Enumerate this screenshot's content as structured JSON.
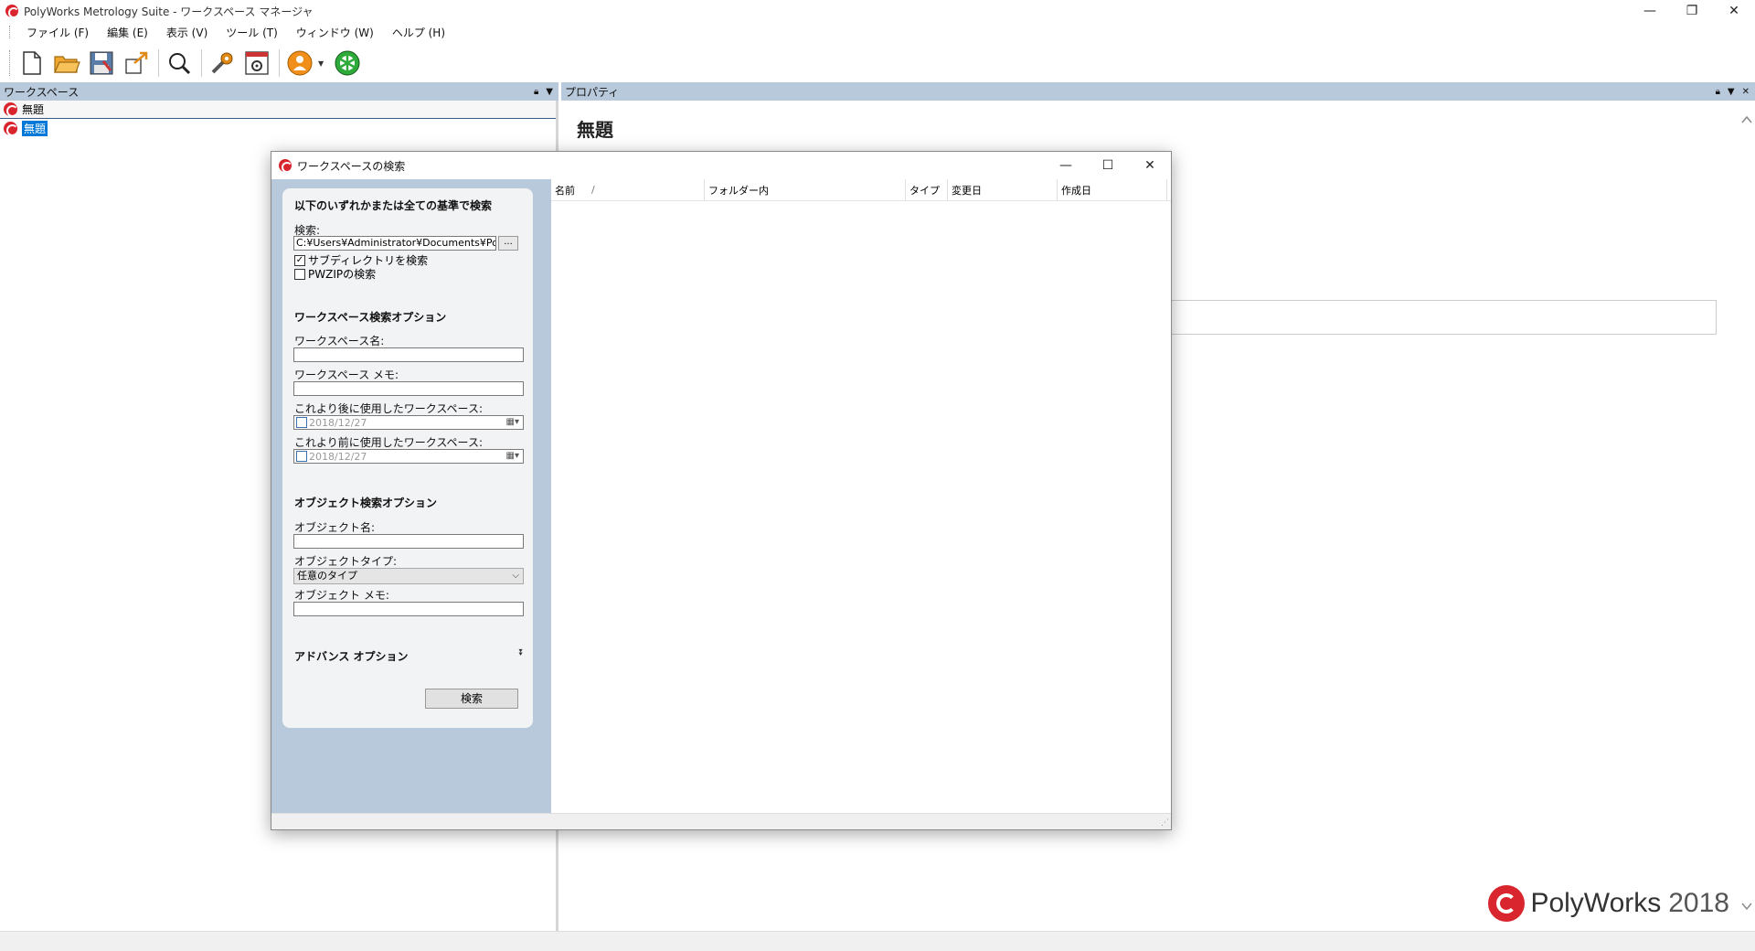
{
  "window": {
    "title": "PolyWorks Metrology Suite - ワークスペース マネージャ",
    "minimize": "—",
    "restore": "❐",
    "close": "✕"
  },
  "menu": [
    {
      "label": "ファイル (F)"
    },
    {
      "label": "編集 (E)"
    },
    {
      "label": "表示 (V)"
    },
    {
      "label": "ツール (T)"
    },
    {
      "label": "ウィンドウ (W)"
    },
    {
      "label": "ヘルプ (H)"
    }
  ],
  "toolbar": {
    "icons": [
      "new-file-icon",
      "open-folder-icon",
      "save-icon",
      "export-icon",
      "search-icon",
      "tools-icon",
      "settings-icon",
      "user-icon",
      "network-icon"
    ]
  },
  "workspace_panel": {
    "title": "ワークスペース",
    "items": [
      {
        "label": "無題"
      },
      {
        "label": "無題"
      }
    ]
  },
  "properties_panel": {
    "title": "プロパティ",
    "heading": "無題"
  },
  "brand": {
    "name": "PolyWorks",
    "year": "2018"
  },
  "dialog": {
    "title": "ワークスペースの検索",
    "criteria_heading": "以下のいずれかまたは全ての基準で検索",
    "search_label": "検索:",
    "search_path": "C:¥Users¥Administrator¥Documents¥PolyWorks",
    "browse": "...",
    "search_subdirs": "サブディレクトリを検索",
    "search_pwzip": "PWZIPの検索",
    "ws_options_heading": "ワークスペース検索オプション",
    "ws_name_label": "ワークスペース名:",
    "ws_memo_label": "ワークスペース メモ:",
    "used_after_label": "これより後に使用したワークスペース:",
    "used_after_value": "2018/12/27",
    "used_before_label": "これより前に使用したワークスペース:",
    "used_before_value": "2018/12/27",
    "obj_options_heading": "オブジェクト検索オプション",
    "obj_name_label": "オブジェクト名:",
    "obj_type_label": "オブジェクトタイプ:",
    "obj_type_value": "任意のタイプ",
    "obj_memo_label": "オブジェクト メモ:",
    "advanced_heading": "アドバンス オプション",
    "search_button": "検索",
    "columns": [
      {
        "label": "名前"
      },
      {
        "label": "フォルダー内"
      },
      {
        "label": "タイプ"
      },
      {
        "label": "変更日"
      },
      {
        "label": "作成日"
      }
    ],
    "sort_indicator": "/"
  }
}
